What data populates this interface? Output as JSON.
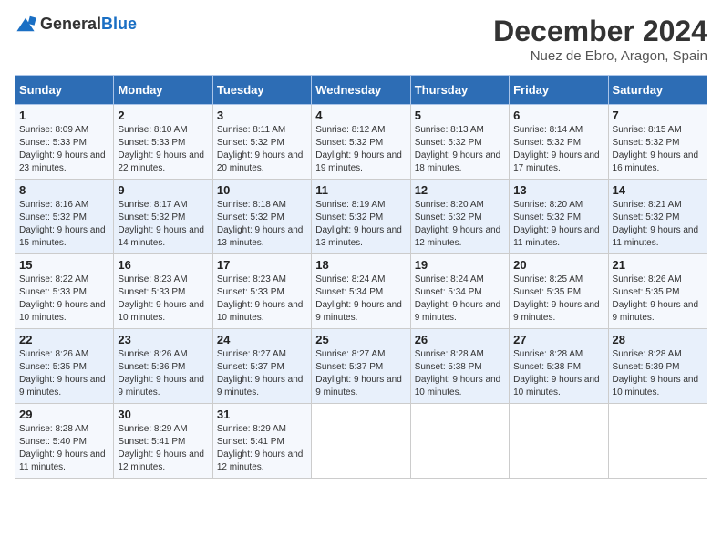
{
  "logo": {
    "general": "General",
    "blue": "Blue"
  },
  "title": "December 2024",
  "subtitle": "Nuez de Ebro, Aragon, Spain",
  "days_of_week": [
    "Sunday",
    "Monday",
    "Tuesday",
    "Wednesday",
    "Thursday",
    "Friday",
    "Saturday"
  ],
  "weeks": [
    [
      {
        "day": "1",
        "sunrise": "8:09 AM",
        "sunset": "5:33 PM",
        "daylight": "9 hours and 23 minutes."
      },
      {
        "day": "2",
        "sunrise": "8:10 AM",
        "sunset": "5:33 PM",
        "daylight": "9 hours and 22 minutes."
      },
      {
        "day": "3",
        "sunrise": "8:11 AM",
        "sunset": "5:32 PM",
        "daylight": "9 hours and 20 minutes."
      },
      {
        "day": "4",
        "sunrise": "8:12 AM",
        "sunset": "5:32 PM",
        "daylight": "9 hours and 19 minutes."
      },
      {
        "day": "5",
        "sunrise": "8:13 AM",
        "sunset": "5:32 PM",
        "daylight": "9 hours and 18 minutes."
      },
      {
        "day": "6",
        "sunrise": "8:14 AM",
        "sunset": "5:32 PM",
        "daylight": "9 hours and 17 minutes."
      },
      {
        "day": "7",
        "sunrise": "8:15 AM",
        "sunset": "5:32 PM",
        "daylight": "9 hours and 16 minutes."
      }
    ],
    [
      {
        "day": "8",
        "sunrise": "8:16 AM",
        "sunset": "5:32 PM",
        "daylight": "9 hours and 15 minutes."
      },
      {
        "day": "9",
        "sunrise": "8:17 AM",
        "sunset": "5:32 PM",
        "daylight": "9 hours and 14 minutes."
      },
      {
        "day": "10",
        "sunrise": "8:18 AM",
        "sunset": "5:32 PM",
        "daylight": "9 hours and 13 minutes."
      },
      {
        "day": "11",
        "sunrise": "8:19 AM",
        "sunset": "5:32 PM",
        "daylight": "9 hours and 13 minutes."
      },
      {
        "day": "12",
        "sunrise": "8:20 AM",
        "sunset": "5:32 PM",
        "daylight": "9 hours and 12 minutes."
      },
      {
        "day": "13",
        "sunrise": "8:20 AM",
        "sunset": "5:32 PM",
        "daylight": "9 hours and 11 minutes."
      },
      {
        "day": "14",
        "sunrise": "8:21 AM",
        "sunset": "5:32 PM",
        "daylight": "9 hours and 11 minutes."
      }
    ],
    [
      {
        "day": "15",
        "sunrise": "8:22 AM",
        "sunset": "5:33 PM",
        "daylight": "9 hours and 10 minutes."
      },
      {
        "day": "16",
        "sunrise": "8:23 AM",
        "sunset": "5:33 PM",
        "daylight": "9 hours and 10 minutes."
      },
      {
        "day": "17",
        "sunrise": "8:23 AM",
        "sunset": "5:33 PM",
        "daylight": "9 hours and 10 minutes."
      },
      {
        "day": "18",
        "sunrise": "8:24 AM",
        "sunset": "5:34 PM",
        "daylight": "9 hours and 9 minutes."
      },
      {
        "day": "19",
        "sunrise": "8:24 AM",
        "sunset": "5:34 PM",
        "daylight": "9 hours and 9 minutes."
      },
      {
        "day": "20",
        "sunrise": "8:25 AM",
        "sunset": "5:35 PM",
        "daylight": "9 hours and 9 minutes."
      },
      {
        "day": "21",
        "sunrise": "8:26 AM",
        "sunset": "5:35 PM",
        "daylight": "9 hours and 9 minutes."
      }
    ],
    [
      {
        "day": "22",
        "sunrise": "8:26 AM",
        "sunset": "5:35 PM",
        "daylight": "9 hours and 9 minutes."
      },
      {
        "day": "23",
        "sunrise": "8:26 AM",
        "sunset": "5:36 PM",
        "daylight": "9 hours and 9 minutes."
      },
      {
        "day": "24",
        "sunrise": "8:27 AM",
        "sunset": "5:37 PM",
        "daylight": "9 hours and 9 minutes."
      },
      {
        "day": "25",
        "sunrise": "8:27 AM",
        "sunset": "5:37 PM",
        "daylight": "9 hours and 9 minutes."
      },
      {
        "day": "26",
        "sunrise": "8:28 AM",
        "sunset": "5:38 PM",
        "daylight": "9 hours and 10 minutes."
      },
      {
        "day": "27",
        "sunrise": "8:28 AM",
        "sunset": "5:38 PM",
        "daylight": "9 hours and 10 minutes."
      },
      {
        "day": "28",
        "sunrise": "8:28 AM",
        "sunset": "5:39 PM",
        "daylight": "9 hours and 10 minutes."
      }
    ],
    [
      {
        "day": "29",
        "sunrise": "8:28 AM",
        "sunset": "5:40 PM",
        "daylight": "9 hours and 11 minutes."
      },
      {
        "day": "30",
        "sunrise": "8:29 AM",
        "sunset": "5:41 PM",
        "daylight": "9 hours and 12 minutes."
      },
      {
        "day": "31",
        "sunrise": "8:29 AM",
        "sunset": "5:41 PM",
        "daylight": "9 hours and 12 minutes."
      },
      null,
      null,
      null,
      null
    ]
  ],
  "labels": {
    "sunrise": "Sunrise:",
    "sunset": "Sunset:",
    "daylight": "Daylight:"
  }
}
